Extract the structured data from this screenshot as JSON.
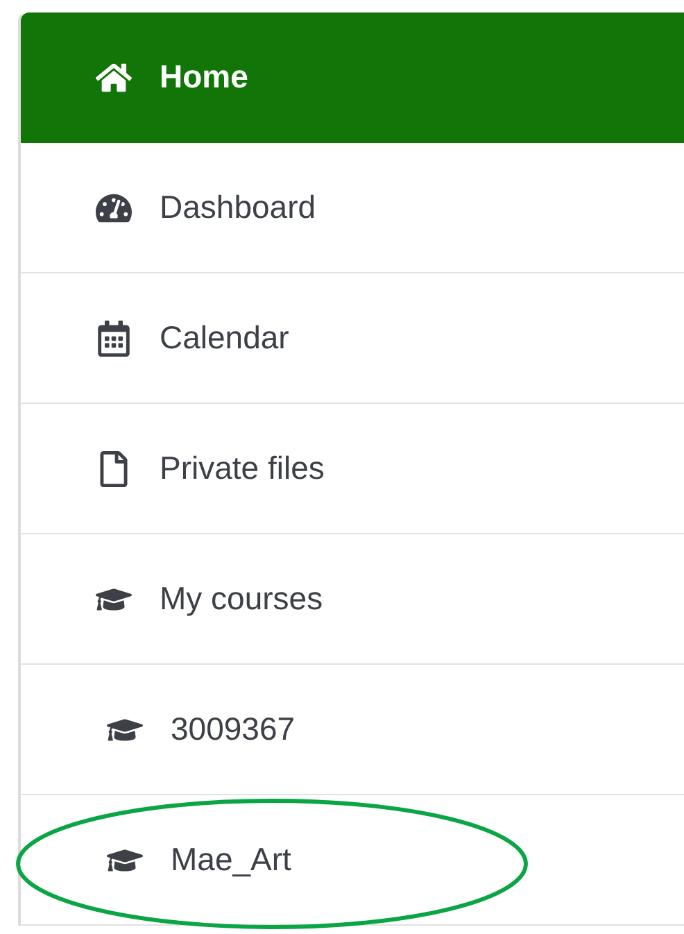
{
  "nav": {
    "items": [
      {
        "label": "Home",
        "selected": true
      },
      {
        "label": "Dashboard",
        "selected": false
      },
      {
        "label": "Calendar",
        "selected": false
      },
      {
        "label": "Private files",
        "selected": false
      },
      {
        "label": "My courses",
        "selected": false,
        "children": [
          {
            "label": "3009367",
            "selected": false,
            "circled": false
          },
          {
            "label": "Mae_Art",
            "selected": false,
            "circled": true
          }
        ]
      }
    ]
  }
}
